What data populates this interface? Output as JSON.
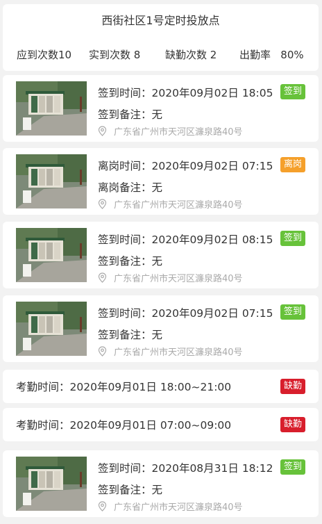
{
  "header": {
    "title": "西街社区1号定时投放点",
    "stats": [
      {
        "label": "应到次数10"
      },
      {
        "label": "实到次数 8"
      },
      {
        "label": "缺勤次数 2"
      },
      {
        "label": "出勤率   80%"
      }
    ]
  },
  "colors": {
    "sign_in": "#67c23a",
    "leave": "#f5a02b",
    "absent": "#d81e2c"
  },
  "records": [
    {
      "type": "record",
      "time": "签到时间：2020年09月02日 18:05",
      "note": "签到备注：无",
      "address": "广东省广州市天河区濂泉路40号",
      "badge": "签到",
      "badge_color": "#67c23a"
    },
    {
      "type": "record",
      "time": "离岗时间：2020年09月02日 07:15",
      "note": "离岗备注：无",
      "address": "广东省广州市天河区濂泉路40号",
      "badge": "离岗",
      "badge_color": "#f5a02b"
    },
    {
      "type": "record",
      "time": "签到时间：2020年09月02日 08:15",
      "note": "签到备注：无",
      "address": "广东省广州市天河区濂泉路40号",
      "badge": "签到",
      "badge_color": "#67c23a"
    },
    {
      "type": "record",
      "time": "签到时间：2020年09月02日 07:15",
      "note": "签到备注：无",
      "address": "广东省广州市天河区濂泉路40号",
      "badge": "签到",
      "badge_color": "#67c23a"
    },
    {
      "type": "absent",
      "text": "考勤时间：2020年09月01日 18:00~21:00",
      "badge": "缺勤",
      "badge_color": "#d81e2c"
    },
    {
      "type": "absent",
      "text": "考勤时间：2020年09月01日 07:00~09:00",
      "badge": "缺勤",
      "badge_color": "#d81e2c"
    },
    {
      "type": "record",
      "time": "签到时间：2020年08月31日 18:12",
      "note": "签到备注：无",
      "address": "广东省广州市天河区濂泉路40号",
      "badge": "签到",
      "badge_color": "#67c23a"
    }
  ]
}
